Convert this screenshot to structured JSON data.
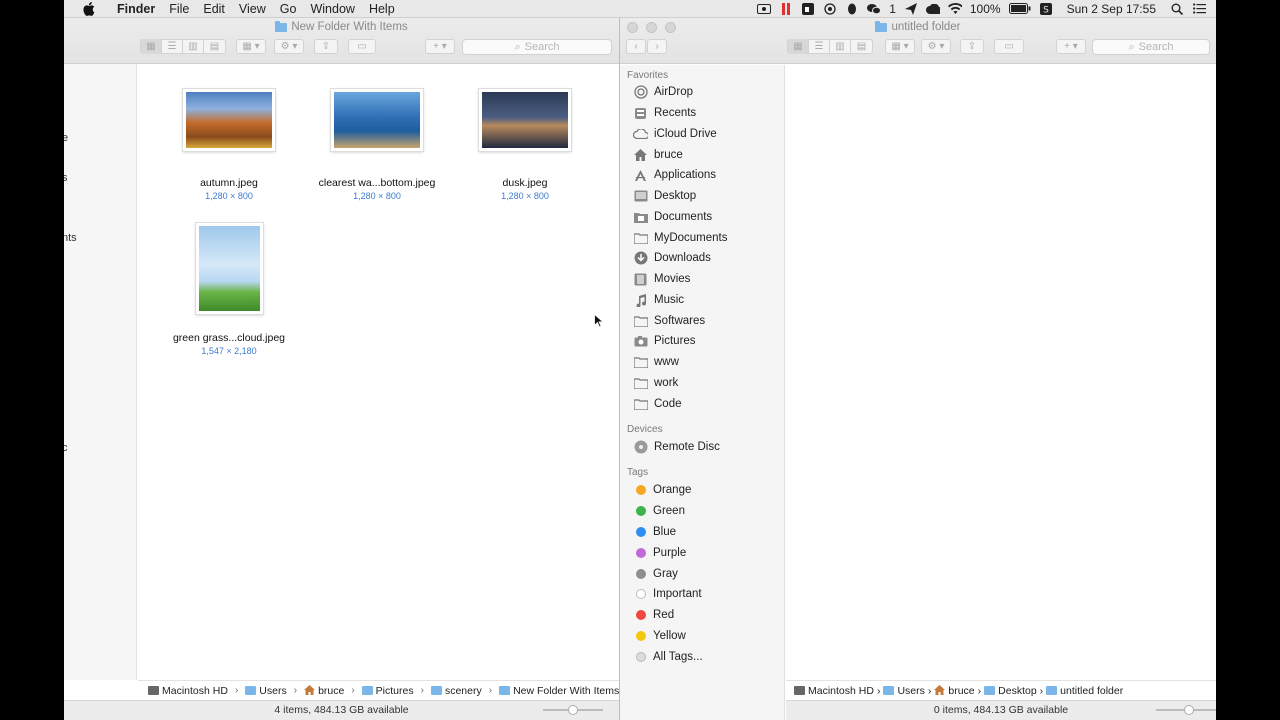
{
  "menubar": {
    "app": "Finder",
    "menus": [
      "File",
      "Edit",
      "View",
      "Go",
      "Window",
      "Help"
    ],
    "battery": "100%",
    "chat_count": "1",
    "datetime": "Sun 2 Sep  17:55",
    "icons": [
      "apple-icon",
      "screen-record-icon",
      "pause-icon",
      "evernote-icon",
      "ocr-icon",
      "qq-icon",
      "wechat-icon",
      "send-icon",
      "cloud-icon",
      "wifi-icon",
      "battery-icon",
      "input-method-icon",
      "spotlight-icon",
      "notification-center-icon"
    ]
  },
  "windowA": {
    "title": "New Folder With Items",
    "search_placeholder": "Search",
    "sidebar_fragments": [
      "e",
      "s",
      "nts",
      "c"
    ],
    "files": [
      {
        "name": "autumn.jpeg",
        "dims": "1,280 × 800",
        "colors": [
          "#c46b2a",
          "#4f7fc1"
        ]
      },
      {
        "name": "clearest wa...bottom.jpeg",
        "dims": "1,280 × 800",
        "colors": [
          "#2f6fb6",
          "#c9a46b"
        ]
      },
      {
        "name": "dusk.jpeg",
        "dims": "1,280 × 800",
        "colors": [
          "#2c3a55",
          "#b88a5c"
        ]
      },
      {
        "name": "green grass...cloud.jpeg",
        "dims": "1,547 × 2,180",
        "colors": [
          "#9fc8ec",
          "#5aa03a"
        ]
      }
    ],
    "path": [
      "Macintosh HD",
      "Users",
      "bruce",
      "Pictures",
      "scenery",
      "New Folder With Items"
    ],
    "status": "4 items, 484.13 GB available"
  },
  "windowB": {
    "title": "untitled folder",
    "search_placeholder": "Search",
    "favorites_header": "Favorites",
    "favorites": [
      {
        "label": "AirDrop",
        "icon": "airdrop-icon"
      },
      {
        "label": "Recents",
        "icon": "recents-icon"
      },
      {
        "label": "iCloud Drive",
        "icon": "icloud-icon"
      },
      {
        "label": "bruce",
        "icon": "home-icon"
      },
      {
        "label": "Applications",
        "icon": "applications-icon"
      },
      {
        "label": "Desktop",
        "icon": "desktop-icon"
      },
      {
        "label": "Documents",
        "icon": "documents-icon"
      },
      {
        "label": "MyDocuments",
        "icon": "folder-icon"
      },
      {
        "label": "Downloads",
        "icon": "downloads-icon"
      },
      {
        "label": "Movies",
        "icon": "movies-icon"
      },
      {
        "label": "Music",
        "icon": "music-icon"
      },
      {
        "label": "Softwares",
        "icon": "folder-icon"
      },
      {
        "label": "Pictures",
        "icon": "pictures-icon"
      },
      {
        "label": "www",
        "icon": "folder-icon"
      },
      {
        "label": "work",
        "icon": "folder-icon"
      },
      {
        "label": "Code",
        "icon": "folder-icon"
      }
    ],
    "devices_header": "Devices",
    "devices": [
      {
        "label": "Remote Disc",
        "icon": "remote-disc-icon"
      }
    ],
    "tags_header": "Tags",
    "tags": [
      {
        "label": "Orange",
        "color": "#f5a623"
      },
      {
        "label": "Green",
        "color": "#3cb44b"
      },
      {
        "label": "Blue",
        "color": "#2f8ff0"
      },
      {
        "label": "Purple",
        "color": "#c16ad8"
      },
      {
        "label": "Gray",
        "color": "#8e8e8e"
      },
      {
        "label": "Important",
        "color": "#ffffff"
      },
      {
        "label": "Red",
        "color": "#f0483e"
      },
      {
        "label": "Yellow",
        "color": "#f2c80f"
      },
      {
        "label": "All Tags...",
        "color": "#dcdcdc"
      }
    ],
    "path": [
      "Macintosh HD",
      "Users",
      "bruce",
      "Desktop",
      "untitled folder"
    ],
    "status": "0 items, 484.13 GB available"
  }
}
